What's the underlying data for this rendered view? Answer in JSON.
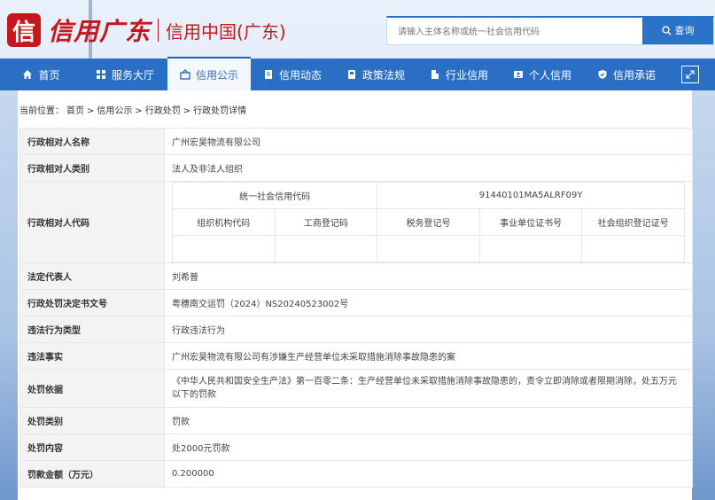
{
  "header": {
    "logo_mark": "信",
    "logo_callig": "信用广东",
    "site_title": "信用中国(广东)"
  },
  "search": {
    "placeholder": "请输入主体名称或统一社会信用代码",
    "button_label": "查询"
  },
  "nav": [
    {
      "label": "首页",
      "icon": "home-icon"
    },
    {
      "label": "服务大厅",
      "icon": "grid-icon"
    },
    {
      "label": "信用公示",
      "icon": "announcement-icon",
      "active": true
    },
    {
      "label": "信用动态",
      "icon": "document-icon"
    },
    {
      "label": "政策法规",
      "icon": "book-icon"
    },
    {
      "label": "行业信用",
      "icon": "building-icon"
    },
    {
      "label": "个人信用",
      "icon": "person-card-icon"
    },
    {
      "label": "信用承诺",
      "icon": "shield-check-icon"
    }
  ],
  "breadcrumb": {
    "prefix": "当前位置：",
    "items": [
      "首页",
      "信用公示",
      "行政处罚",
      "行政处罚详情"
    ],
    "separator": ">"
  },
  "detail": {
    "name_label": "行政相对人名称",
    "name_value": "广州宏昊物流有限公司",
    "type_label": "行政相对人类别",
    "type_value": "法人及非法人组织",
    "code_label": "行政相对人代码",
    "usc_label": "统一社会信用代码",
    "usc_value": "91440101MA5ALRF09Y",
    "code_cols": [
      "组织机构代码",
      "工商登记码",
      "税务登记号",
      "事业单位证书号",
      "社会组织登记证号"
    ],
    "code_vals": [
      "",
      "",
      "",
      "",
      ""
    ],
    "rep_label": "法定代表人",
    "rep_value": "刘希普",
    "doc_label": "行政处罚决定书文号",
    "doc_value": "粤穗南交运罚（2024）NS20240523002号",
    "vtype_label": "违法行为类型",
    "vtype_value": "行政违法行为",
    "fact_label": "违法事实",
    "fact_value": "广州宏昊物流有限公司有涉嫌生产经营单位未采取措施消除事故隐患的案",
    "basis_label": "处罚依据",
    "basis_value": "《中华人民共和国安全生产法》第一百零二条：生产经营单位未采取措施消除事故隐患的，责令立即消除或者限期消除，处五万元以下的罚款",
    "ptype_label": "处罚类别",
    "ptype_value": "罚款",
    "content_label": "处罚内容",
    "content_value": "处2000元罚款",
    "amount_label": "罚款金额（万元）",
    "amount_value": "0.200000"
  },
  "colors": {
    "brand_red": "#c8161d",
    "nav_blue": "#2b6fc5"
  }
}
